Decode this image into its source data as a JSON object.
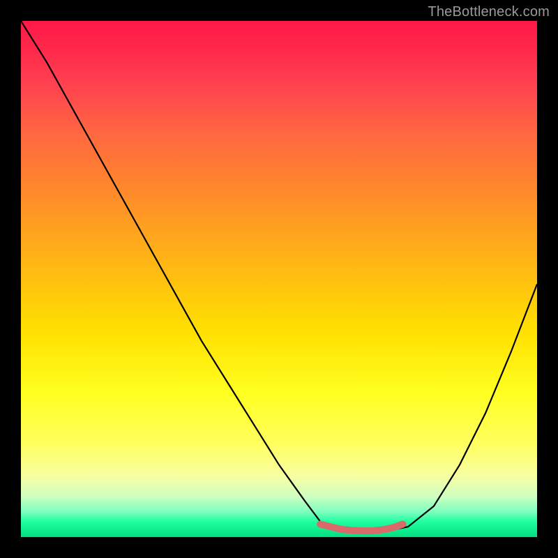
{
  "watermark": "TheBottleneck.com",
  "chart_data": {
    "type": "line",
    "title": "",
    "xlabel": "",
    "ylabel": "",
    "xlim": [
      0,
      100
    ],
    "ylim": [
      0,
      100
    ],
    "grid": false,
    "background_gradient": {
      "top": "#ff1848",
      "middle": "#ffe000",
      "bottom": "#00e080"
    },
    "series": [
      {
        "name": "bottleneck-curve",
        "color": "#000000",
        "x": [
          0,
          5,
          10,
          15,
          20,
          25,
          30,
          35,
          40,
          45,
          50,
          55,
          58,
          62,
          65,
          70,
          75,
          80,
          85,
          90,
          95,
          100
        ],
        "y": [
          100,
          92,
          83,
          74,
          65,
          56,
          47,
          38,
          30,
          22,
          14,
          7,
          3,
          1,
          1,
          1,
          2,
          6,
          14,
          24,
          36,
          49
        ]
      },
      {
        "name": "optimal-zone",
        "color": "#d96a6a",
        "type": "marker",
        "x": [
          58,
          60,
          62,
          64,
          66,
          68,
          70,
          72,
          74
        ],
        "y": [
          2.5,
          2,
          1.5,
          1.3,
          1.2,
          1.2,
          1.4,
          1.8,
          2.5
        ]
      }
    ],
    "annotations": []
  }
}
